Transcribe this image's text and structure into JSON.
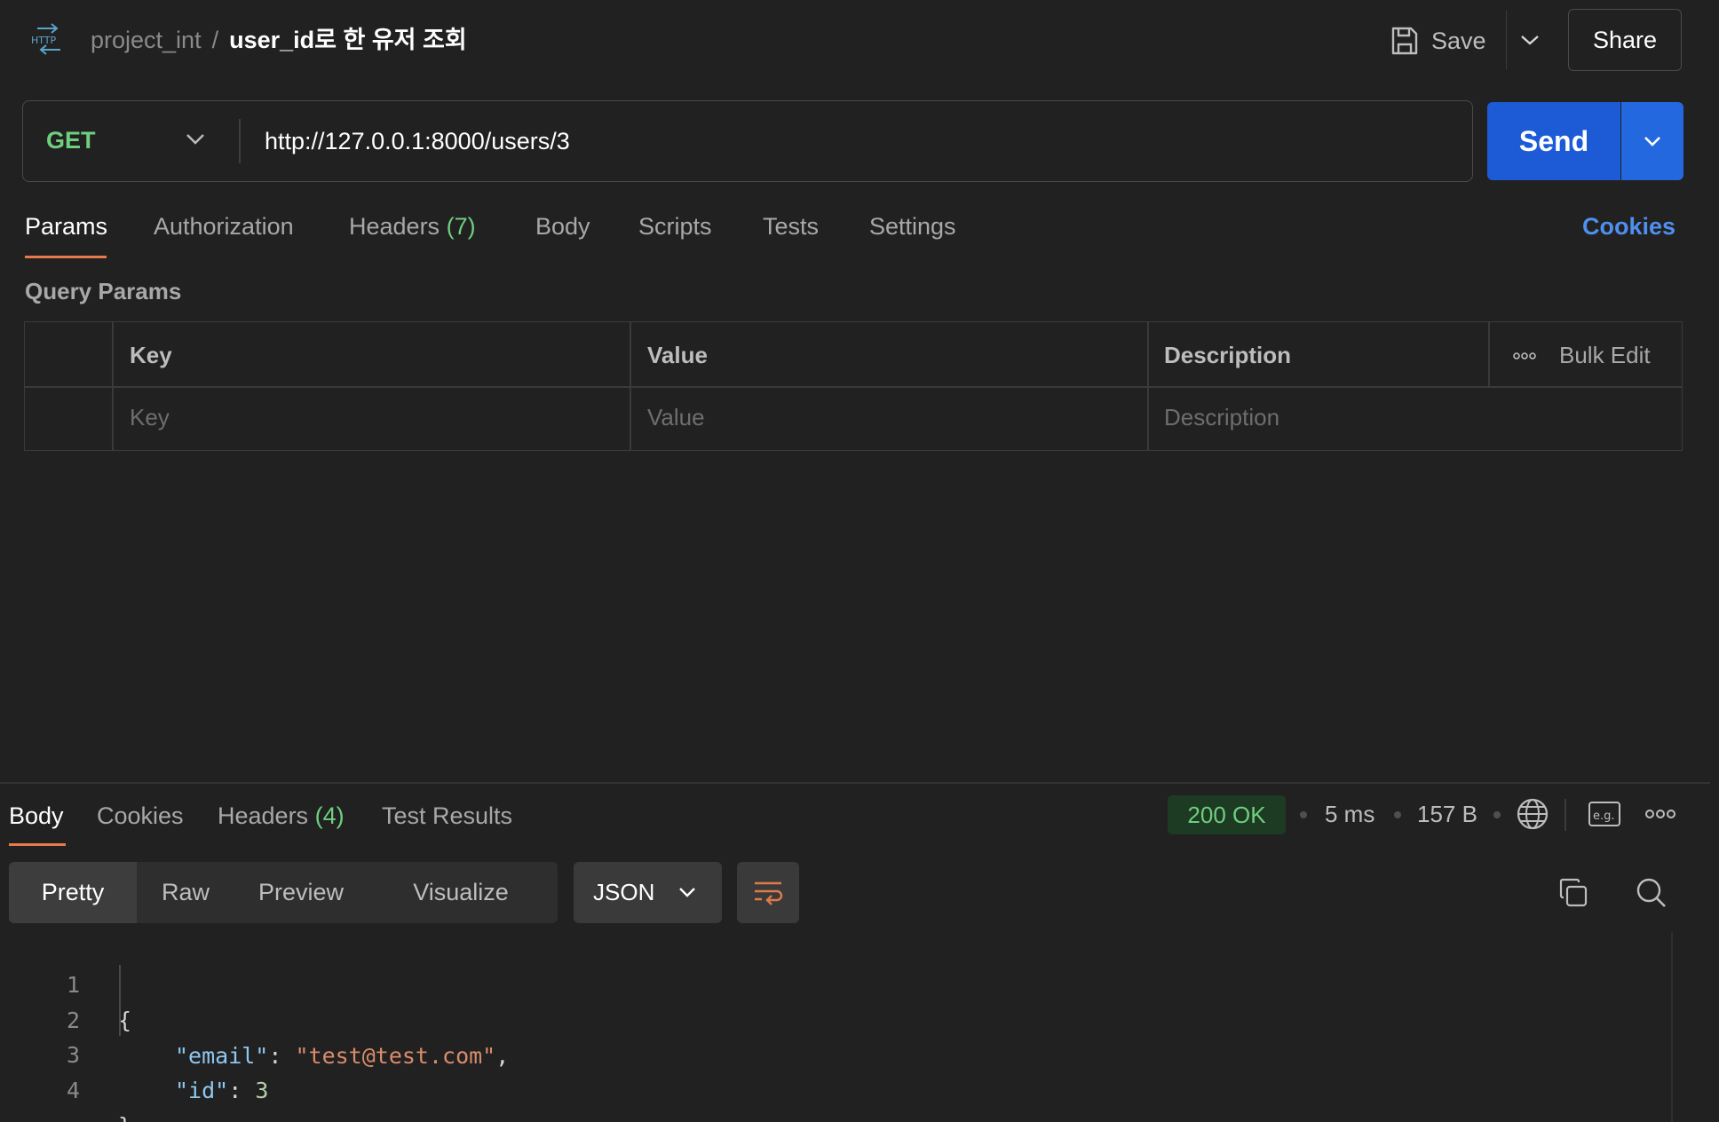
{
  "header": {
    "icon": "http-icon",
    "project": "project_int",
    "separator": "/",
    "request_name": "user_id로 한 유저 조회",
    "save_label": "Save",
    "share_label": "Share"
  },
  "request": {
    "method": "GET",
    "url": "http://127.0.0.1:8000/users/3",
    "send_label": "Send"
  },
  "request_tabs": {
    "params": "Params",
    "authorization": "Authorization",
    "headers": "Headers",
    "headers_count": "(7)",
    "body": "Body",
    "scripts": "Scripts",
    "tests": "Tests",
    "settings": "Settings",
    "cookies": "Cookies"
  },
  "query_params": {
    "title": "Query Params",
    "columns": {
      "key": "Key",
      "value": "Value",
      "description": "Description"
    },
    "bulk_edit": "Bulk Edit",
    "placeholders": {
      "key": "Key",
      "value": "Value",
      "description": "Description"
    }
  },
  "response": {
    "tabs": {
      "body": "Body",
      "cookies": "Cookies",
      "headers": "Headers",
      "headers_count": "(4)",
      "test_results": "Test Results"
    },
    "status": "200 OK",
    "time": "5 ms",
    "size": "157 B",
    "formats": {
      "pretty": "Pretty",
      "raw": "Raw",
      "preview": "Preview",
      "visualize": "Visualize"
    },
    "language": "JSON",
    "lines": [
      {
        "n": "1",
        "open": "{"
      },
      {
        "n": "2",
        "key": "\"email\"",
        "colon": ": ",
        "str": "\"test@test.com\"",
        "comma": ","
      },
      {
        "n": "3",
        "key": "\"id\"",
        "colon": ": ",
        "num": "3"
      },
      {
        "n": "4",
        "close": "}"
      }
    ]
  },
  "colors": {
    "background": "#212121",
    "accent_send": "#1d5bd6",
    "method_get": "#6fcf7f",
    "tab_active_underline": "#e8794a",
    "link": "#4f8ff0",
    "status_ok_bg": "#1d3a22",
    "status_ok_text": "#6fcf7f"
  }
}
